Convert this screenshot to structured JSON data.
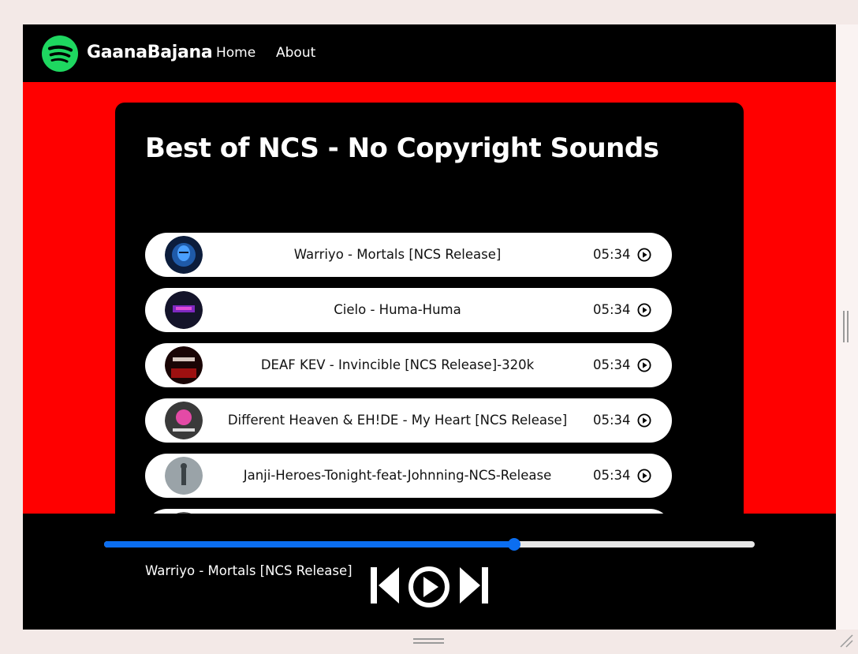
{
  "nav": {
    "brand": "GaanaBajana",
    "links": [
      {
        "label": "Home"
      },
      {
        "label": "About"
      }
    ]
  },
  "playlist": {
    "title": "Best of NCS - No Copyright Sounds",
    "songs": [
      {
        "name": "Warriyo - Mortals [NCS Release]",
        "duration": "05:34"
      },
      {
        "name": "Cielo - Huma-Huma",
        "duration": "05:34"
      },
      {
        "name": "DEAF KEV - Invincible [NCS Release]-320k",
        "duration": "05:34"
      },
      {
        "name": "Different Heaven & EH!DE - My Heart [NCS Release]",
        "duration": "05:34"
      },
      {
        "name": "Janji-Heroes-Tonight-feat-Johnning-NCS-Release",
        "duration": "05:34"
      },
      {
        "name": "",
        "duration": ""
      }
    ]
  },
  "player": {
    "now_playing": "Warriyo - Mortals [NCS Release]",
    "progress_percent": 63
  },
  "colors": {
    "page_background": "#ff0000",
    "brand_green": "#1ed760",
    "progress_blue": "#0b6ef0"
  },
  "icons": {
    "logo": "spotify-logo-icon",
    "song_play": "play-circle-icon",
    "previous": "skip-previous-icon",
    "play": "play-circle-icon",
    "next": "skip-next-icon"
  }
}
